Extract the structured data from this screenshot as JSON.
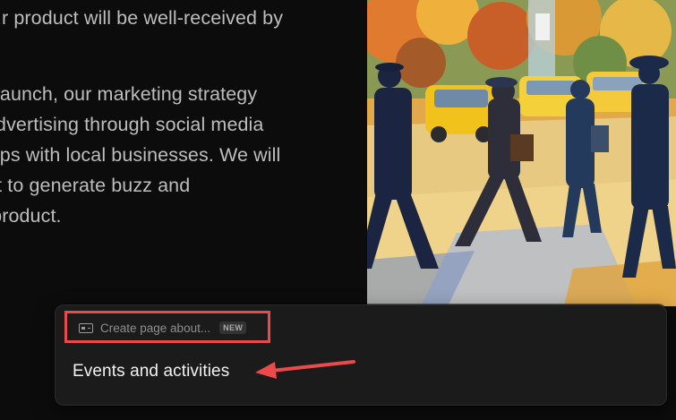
{
  "article": {
    "lines": [
      "r product will be well-received by",
      "ul launch, our marketing strategy",
      "l advertising through social media",
      "ships with local businesses. We will",
      "ent to generate buzz and",
      "e product."
    ]
  },
  "image": {
    "alt": "Painted street scene of people walking among yellow cars in autumn"
  },
  "command_panel": {
    "create_label": "Create page about...",
    "new_badge": "NEW",
    "suggestion": "Events and activities"
  },
  "annotations": {
    "highlight_color": "#ea4a4a",
    "arrow_color": "#ea4a4a"
  }
}
